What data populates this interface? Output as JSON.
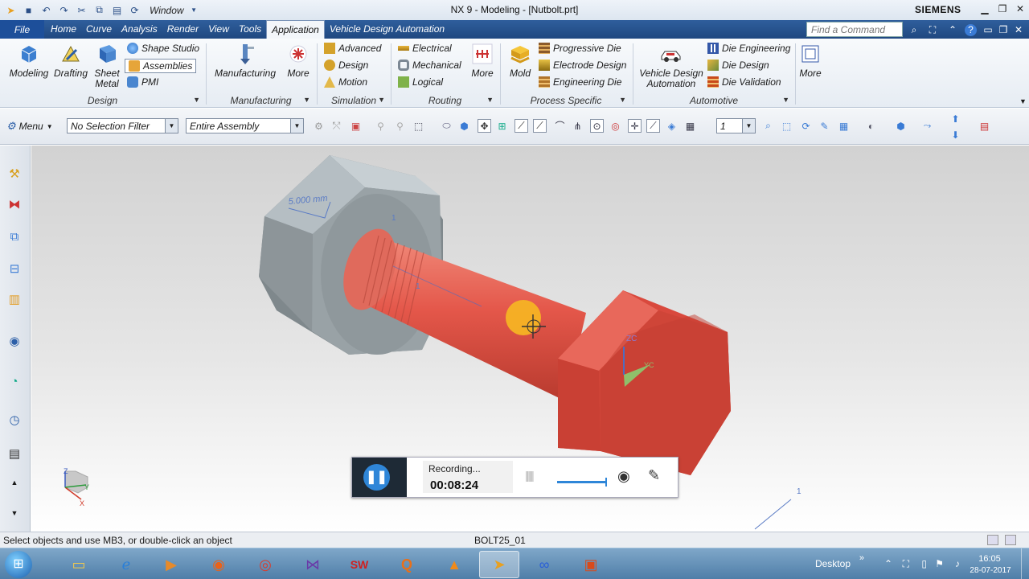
{
  "titlebar": {
    "title": "NX 9 - Modeling - [Nutbolt.prt]",
    "brand": "SIEMENS",
    "window_menu": "Window"
  },
  "tabs": {
    "file": "File",
    "items": [
      "Home",
      "Curve",
      "Analysis",
      "Render",
      "View",
      "Tools",
      "Application",
      "Vehicle Design Automation"
    ],
    "active": "Application",
    "find_placeholder": "Find a Command"
  },
  "ribbon": {
    "design": {
      "label": "Design",
      "modeling": "Modeling",
      "drafting": "Drafting",
      "sheet_metal": "Sheet Metal",
      "shape_studio": "Shape Studio",
      "assemblies": "Assemblies",
      "pmi": "PMI"
    },
    "manufacturing": {
      "label": "Manufacturing",
      "manufacturing": "Manufacturing",
      "more": "More"
    },
    "simulation": {
      "label": "Simulation",
      "advanced": "Advanced",
      "design": "Design",
      "motion": "Motion"
    },
    "routing": {
      "label": "Routing",
      "electrical": "Electrical",
      "mechanical": "Mechanical",
      "logical": "Logical",
      "more": "More"
    },
    "process": {
      "label": "Process Specific",
      "mold": "Mold",
      "progressive_die": "Progressive Die",
      "electrode_design": "Electrode Design",
      "engineering_die": "Engineering Die"
    },
    "automotive": {
      "label": "Automotive",
      "vehicle_design": "Vehicle Design Automation",
      "die_engineering": "Die Engineering",
      "die_design": "Die Design",
      "die_validation": "Die Validation",
      "more": "More"
    }
  },
  "toolbar": {
    "menu": "Menu",
    "selection_filter": "No Selection Filter",
    "assembly_scope": "Entire Assembly",
    "layer": "1"
  },
  "viewport": {
    "dimension": "5.000 mm",
    "csys_zc": "ZC",
    "csys_yc": "YC",
    "triad_z": "Z",
    "triad_y": "Y",
    "triad_x": "X",
    "marker": "1",
    "colors": {
      "bolt": "#e4574a",
      "nut": "#8e979b"
    }
  },
  "status": {
    "message": "Select objects and use MB3, or double-click an object",
    "selection": "BOLT25_01"
  },
  "recorder": {
    "label": "Recording...",
    "time": "00:08:24"
  },
  "taskbar": {
    "desktop": "Desktop",
    "time": "16:05",
    "date": "28-07-2017"
  }
}
